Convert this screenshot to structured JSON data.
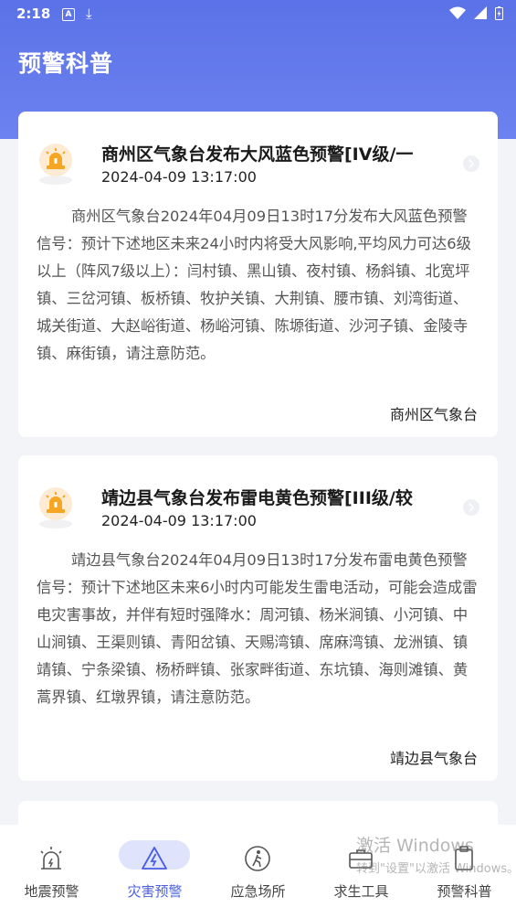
{
  "status_bar": {
    "time": "2:18",
    "notification_letter": "A"
  },
  "header": {
    "title": "预警科普"
  },
  "cards": [
    {
      "title": "商州区气象台发布大风蓝色预警[IV级/一",
      "time": "2024-04-09 13:17:00",
      "body": "商州区气象台2024年04月09日13时17分发布大风蓝色预警信号：预计下述地区未来24小时内将受大风影响,平均风力可达6级以上（阵风7级以上）：闫村镇、黑山镇、夜村镇、杨斜镇、北宽坪镇、三岔河镇、板桥镇、牧护关镇、大荆镇、腰市镇、刘湾街道、城关街道、大赵峪街道、杨峪河镇、陈塬街道、沙河子镇、金陵寺镇、麻街镇，请注意防范。",
      "source": "商州区气象台"
    },
    {
      "title": "靖边县气象台发布雷电黄色预警[III级/较",
      "time": "2024-04-09 13:17:00",
      "body": "靖边县气象台2024年04月09日13时17分发布雷电黄色预警信号：预计下述地区未来6小时内可能发生雷电活动，可能会造成雷电灾害事故，并伴有短时强降水：周河镇、杨米涧镇、小河镇、中山涧镇、王渠则镇、青阳岔镇、天赐湾镇、席麻湾镇、龙洲镇、镇靖镇、宁条梁镇、杨桥畔镇、张家畔街道、东坑镇、海则滩镇、黄蒿界镇、红墩界镇，请注意防范。",
      "source": "靖边县气象台"
    }
  ],
  "watermark": {
    "line1": "激活 Windows",
    "line2": "转到\"设置\"以激活 Windows。"
  },
  "tabs": [
    {
      "label": "地震预警",
      "icon": "earthquake-alert-icon"
    },
    {
      "label": "灾害预警",
      "icon": "lightning-warning-icon",
      "active": true
    },
    {
      "label": "应急场所",
      "icon": "evacuation-person-icon"
    },
    {
      "label": "求生工具",
      "icon": "toolbox-icon"
    },
    {
      "label": "预警科普",
      "icon": "clipboard-icon"
    }
  ],
  "colors": {
    "accent": "#4a5fe0",
    "header": "#5b72e8",
    "alarm": "#f5a623"
  }
}
